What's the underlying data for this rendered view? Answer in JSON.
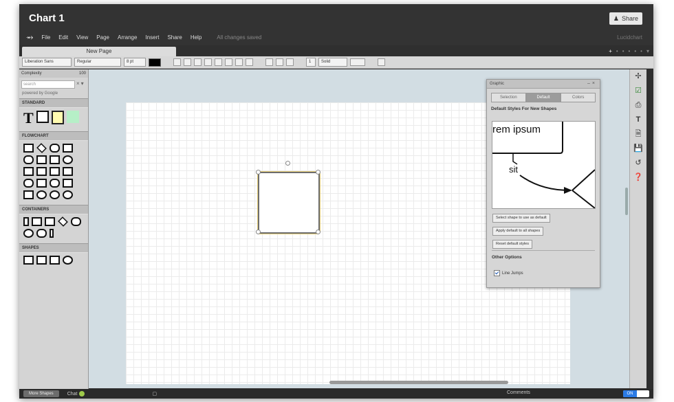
{
  "app": {
    "title": "Chart 1",
    "share_label": "Share",
    "user_name": "Lucidchart",
    "status": "All changes saved"
  },
  "menu": [
    "File",
    "Edit",
    "View",
    "Page",
    "Arrange",
    "Insert",
    "Share",
    "Help"
  ],
  "page_tab": "New Page",
  "toolbar": {
    "font_family": "Liberation Sans",
    "font_style": "Regular",
    "font_size": "8 pt",
    "line_width": "1",
    "line_style": "Solid"
  },
  "sidebar": {
    "zoom_label": "Complexity",
    "zoom_value": "100",
    "search_placeholder": "search",
    "powered_by": "powered by Google",
    "sections": [
      "STANDARD",
      "FLOWCHART",
      "CONTAINERS",
      "SHAPES"
    ]
  },
  "panel": {
    "header": "Graphic",
    "tabs": [
      "Selection",
      "Default",
      "Colors"
    ],
    "title": "Default Styles For New Shapes",
    "preview_text1": "rem ipsum",
    "preview_text2": "sit",
    "buttons": [
      "Select shape to use as default",
      "Apply default to all shapes",
      "Reset default styles"
    ],
    "other_title": "Other Options",
    "checkbox_label": "Line Jumps"
  },
  "bottom": {
    "more_shapes": "More Shapes",
    "chat": "Chat",
    "comments": "Comments",
    "toggle": "ON"
  },
  "colors": {
    "accent": "#2c7be5",
    "chat_status": "#9ec94a",
    "note_fill": "#fffbb0",
    "green_shape": "#b6efc7"
  }
}
